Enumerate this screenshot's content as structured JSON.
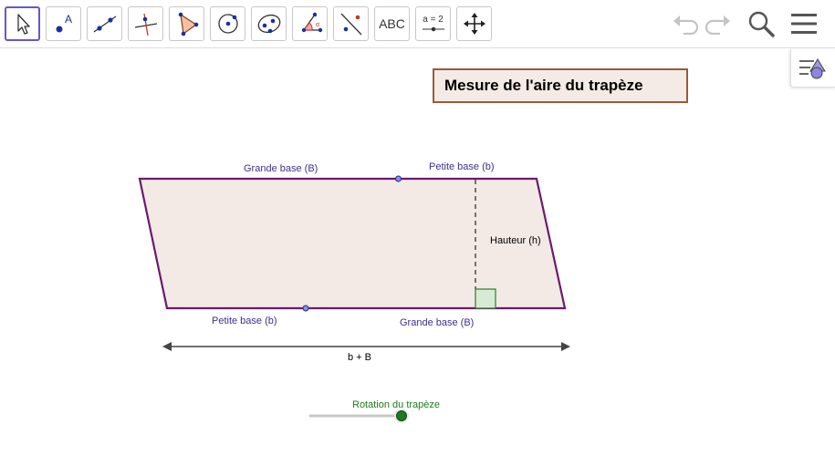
{
  "toolbar": {
    "tools": [
      {
        "name": "move-tool",
        "icon": "cursor-arrow-icon"
      },
      {
        "name": "point-tool",
        "icon": "point-a-icon"
      },
      {
        "name": "line-tool",
        "icon": "line-through-points-icon"
      },
      {
        "name": "perpendicular-line-tool",
        "icon": "perpendicular-line-icon"
      },
      {
        "name": "polygon-tool",
        "icon": "polygon-icon"
      },
      {
        "name": "circle-tool",
        "icon": "circle-center-point-icon"
      },
      {
        "name": "ellipse-tool",
        "icon": "ellipse-icon"
      },
      {
        "name": "angle-tool",
        "icon": "angle-icon"
      },
      {
        "name": "reflect-tool",
        "icon": "reflect-about-line-icon"
      },
      {
        "name": "text-tool",
        "label": "ABC"
      },
      {
        "name": "slider-tool",
        "label": "a = 2"
      },
      {
        "name": "move-graphics-view-tool",
        "icon": "move-arrows-icon"
      }
    ],
    "right_buttons": [
      "undo-icon",
      "redo-icon",
      "search-icon",
      "menu-icon"
    ]
  },
  "algebra_toggle": {
    "icon": "algebra-view-icon"
  },
  "title": "Mesure de l'aire du trapèze",
  "figure": {
    "labels": {
      "grande_base_top": "Grande base (B)",
      "petite_base_top": "Petite base (b)",
      "hauteur": "Hauteur (h)",
      "petite_base_bottom": "Petite base (b)",
      "grande_base_bottom": "Grande base (B)",
      "sum": "b + B"
    }
  },
  "slider": {
    "label": "Rotation du trapèze",
    "value": 1.0
  },
  "colors": {
    "accent": "#6557d2",
    "shape_fill": "#f3e9e5",
    "shape_stroke": "#6a1b6e",
    "label_color": "#3e2f8f",
    "slider_label": "#1e7b1e",
    "slider_knob": "#1f7a1f",
    "title_border": "#9b5a37",
    "title_bg": "#f5ebe6"
  }
}
